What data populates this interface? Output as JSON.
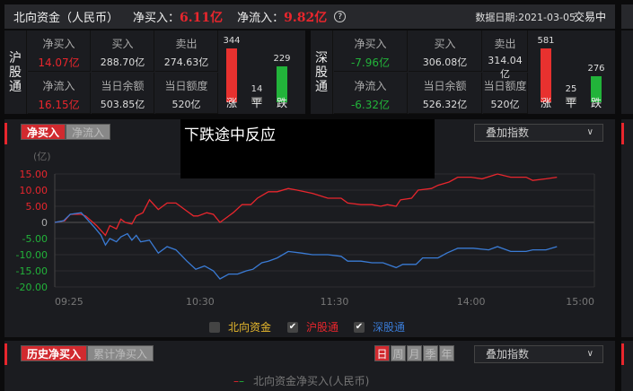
{
  "header": {
    "title": "北向资金（人民币）",
    "net_buy_label": "净买入：",
    "net_buy": "6.11亿",
    "net_flow_label": "净流入：",
    "net_flow": "9.82亿",
    "help_icon": "?",
    "date": "数据日期:2021-03-05",
    "status": "交易中"
  },
  "sh": {
    "name": [
      "沪",
      "股",
      "通"
    ],
    "net_buy_label": "净买入",
    "net_buy": "14.07亿",
    "buy_label": "买入",
    "buy": "288.70亿",
    "sell_label": "卖出",
    "sell": "274.63亿",
    "net_flow_label": "净流入",
    "net_flow": "16.15亿",
    "balance_label": "当日余额",
    "balance": "503.85亿",
    "quota_label": "当日额度",
    "quota": "520亿",
    "up": 344,
    "flat": 14,
    "down": 229,
    "up_label": "涨",
    "flat_label": "平",
    "down_label": "跌"
  },
  "sz": {
    "name": [
      "深",
      "股",
      "通"
    ],
    "net_buy_label": "净买入",
    "net_buy": "-7.96亿",
    "buy_label": "买入",
    "buy": "306.08亿",
    "sell_label": "卖出",
    "sell": "314.04亿",
    "net_flow_label": "净流入",
    "net_flow": "-6.32亿",
    "balance_label": "当日余额",
    "balance": "526.32亿",
    "quota_label": "当日额度",
    "quota": "520亿",
    "up": 581,
    "flat": 25,
    "down": 276,
    "up_label": "涨",
    "flat_label": "平",
    "down_label": "跌"
  },
  "chart_panel": {
    "tabs": [
      "净买入",
      "净流入"
    ],
    "overlay_select": "叠加指数",
    "overlay_text": "下跌途中反应",
    "legend": [
      {
        "label": "北向资金",
        "checked": false,
        "color": "#e8b92d"
      },
      {
        "label": "沪股通",
        "checked": true,
        "color": "#e8262d"
      },
      {
        "label": "深股通",
        "checked": true,
        "color": "#3a7bd5"
      }
    ]
  },
  "chart_data": {
    "type": "line",
    "ylabel": "(亿)",
    "ylim": [
      -20,
      15
    ],
    "yticks": [
      15,
      10,
      5,
      0,
      -5,
      -10,
      -15,
      -20
    ],
    "ytick_labels": [
      "15.00",
      "10.00",
      "5.00",
      "0",
      "-5.00",
      "-10.00",
      "-15.00",
      "-20.00"
    ],
    "xlim": [
      0,
      245
    ],
    "xticks": [
      0,
      66,
      127,
      189,
      245
    ],
    "xtick_labels": [
      "09:25",
      "10:30",
      "11:30",
      "14:00",
      "15:00"
    ],
    "grid": true,
    "series": [
      {
        "name": "沪股通",
        "color": "#e8262d",
        "x": [
          0,
          4.5,
          7,
          12,
          14,
          19,
          23,
          25,
          28,
          30,
          32,
          35,
          37,
          40,
          43,
          47,
          51,
          55,
          59,
          63,
          65,
          69,
          72,
          75,
          78,
          81,
          85,
          89,
          92,
          97,
          101,
          106,
          110,
          117,
          124,
          130,
          133,
          139,
          144,
          148,
          151,
          155,
          157,
          162,
          165,
          171,
          174,
          179,
          183,
          189,
          194,
          201,
          207,
          214,
          217,
          223,
          228
        ],
        "y": [
          0,
          0.5,
          2.5,
          2.5,
          2,
          -1,
          -4,
          -1,
          -2,
          1,
          0,
          -0.5,
          2,
          3,
          7,
          4,
          6,
          6,
          4,
          2,
          2,
          3,
          2.5,
          0,
          1.5,
          3,
          5.5,
          5.5,
          7.5,
          9.5,
          9.5,
          10.5,
          10,
          9,
          7.5,
          7.5,
          6,
          5.5,
          5.5,
          5,
          5.5,
          5,
          7,
          7.5,
          10,
          10.5,
          11.5,
          12.5,
          14,
          14,
          13.5,
          15,
          14,
          14,
          13,
          13.5,
          14
        ]
      },
      {
        "name": "深股通",
        "color": "#3a7bd5",
        "x": [
          0,
          4,
          7,
          12,
          14,
          18,
          21,
          23,
          25,
          28,
          30,
          33,
          35,
          37,
          39,
          43,
          47,
          51,
          55,
          60,
          64,
          68,
          72,
          75,
          79,
          83,
          87,
          90,
          94,
          97,
          101,
          106,
          112,
          117,
          124,
          130,
          133,
          139,
          144,
          149,
          155,
          158,
          164,
          167,
          174,
          178,
          183,
          190,
          197,
          201,
          207,
          214,
          217,
          223,
          228
        ],
        "y": [
          0,
          0.5,
          2.5,
          3,
          1.5,
          -1.5,
          -4,
          -7,
          -5,
          -6,
          -4.5,
          -3.5,
          -5.5,
          -4,
          -6,
          -5.5,
          -9.5,
          -7.5,
          -8.5,
          -12,
          -14.5,
          -13.5,
          -15,
          -17.5,
          -16,
          -16,
          -15,
          -14.5,
          -12.5,
          -12,
          -11,
          -9,
          -9.5,
          -10,
          -10,
          -10.5,
          -12,
          -12,
          -12.5,
          -12.5,
          -14,
          -13,
          -13,
          -11,
          -11,
          -9.5,
          -8,
          -8,
          -8.5,
          -7.5,
          -9,
          -9,
          -8.5,
          -8.5,
          -7.5
        ]
      }
    ]
  },
  "history": {
    "tabs": [
      "历史净买入",
      "累计净买入"
    ],
    "periods": [
      "日",
      "周",
      "月",
      "季",
      "年"
    ],
    "overlay_select": "叠加指数",
    "legend": "北向资金净买入(人民币)"
  }
}
